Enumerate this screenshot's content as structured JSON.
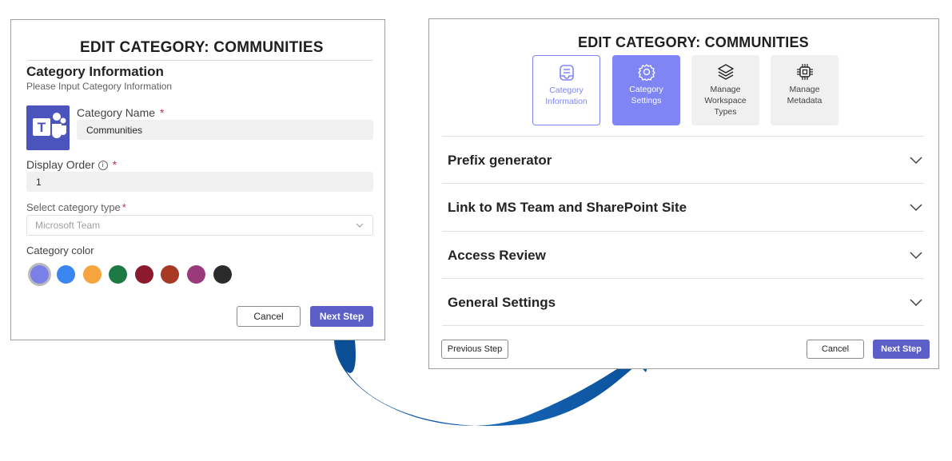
{
  "left": {
    "title": "EDIT CATEGORY: COMMUNITIES",
    "section_title": "Category Information",
    "section_subtitle": "Please Input Category Information",
    "category_name_label": "Category Name",
    "category_name_value": "Communities",
    "display_order_label": "Display Order",
    "display_order_value": "1",
    "required_mark": "*",
    "category_type_label": "Select category type",
    "category_type_value": "Microsoft Team",
    "category_color_label": "Category color",
    "colors": [
      "#7b7fe8",
      "#3a86f0",
      "#f5a53d",
      "#1e7a45",
      "#8a1a2c",
      "#a83a25",
      "#9a3a7a",
      "#2b2b2b"
    ],
    "cancel_label": "Cancel",
    "next_label": "Next Step"
  },
  "right": {
    "title": "EDIT CATEGORY: COMMUNITIES",
    "tiles": [
      {
        "label": "Category Information",
        "icon": "clipboard-icon"
      },
      {
        "label": "Category Settings",
        "icon": "settings-icon"
      },
      {
        "label": "Manage Workspace Types",
        "icon": "layers-icon"
      },
      {
        "label": "Manage Metadata",
        "icon": "chip-icon"
      }
    ],
    "sections": [
      "Prefix generator",
      "Link to MS Team and SharePoint Site",
      "Access Review",
      "General Settings"
    ],
    "previous_label": "Previous Step",
    "cancel_label": "Cancel",
    "next_label": "Next Step"
  },
  "colors": {
    "accent": "#5b5fc7",
    "accent_light": "#7f85f5",
    "arrow": "#0c5aa8"
  }
}
